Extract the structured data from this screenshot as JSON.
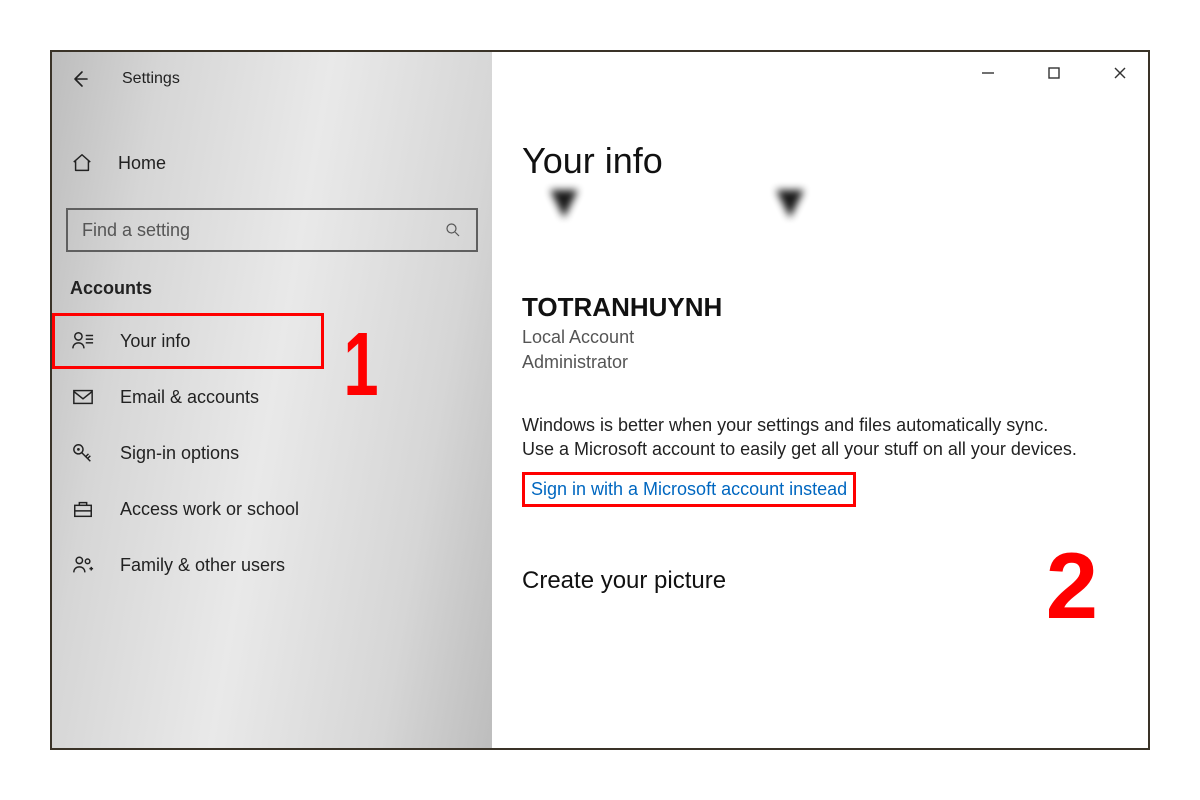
{
  "header": {
    "title": "Settings"
  },
  "sidebar": {
    "home_label": "Home",
    "search_placeholder": "Find a setting",
    "section_label": "Accounts",
    "items": [
      {
        "label": "Your info",
        "icon": "person-info-icon",
        "selected": true
      },
      {
        "label": "Email & accounts",
        "icon": "mail-icon",
        "selected": false
      },
      {
        "label": "Sign-in options",
        "icon": "key-icon",
        "selected": false
      },
      {
        "label": "Access work or school",
        "icon": "briefcase-icon",
        "selected": false
      },
      {
        "label": "Family & other users",
        "icon": "people-add-icon",
        "selected": false
      }
    ]
  },
  "main": {
    "page_title": "Your info",
    "username": "TOTRANHUYNH",
    "account_type": "Local Account",
    "role": "Administrator",
    "description": "Windows is better when your settings and files automatically sync. Use a Microsoft account to easily get all your stuff on all your devices.",
    "signin_link": "Sign in with a Microsoft account instead",
    "picture_section": "Create your picture"
  },
  "annotations": {
    "one": "1",
    "two": "2"
  },
  "colors": {
    "accent_red": "#ff0000",
    "link_blue": "#0067c0"
  }
}
